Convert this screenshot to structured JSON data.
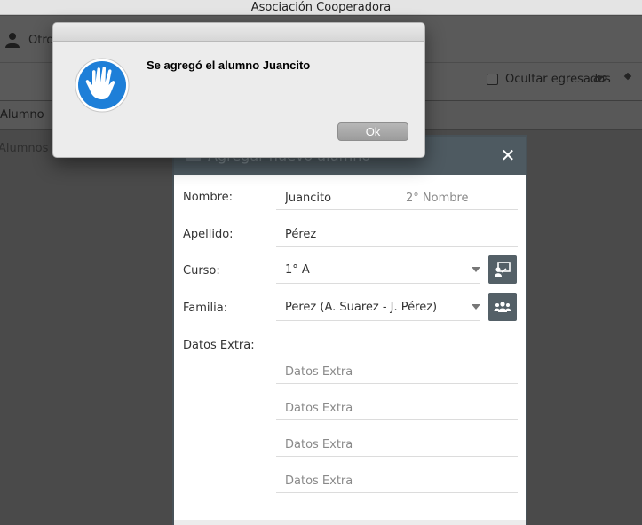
{
  "window": {
    "title": "Asociación Cooperadora"
  },
  "background_app": {
    "user_label": "Otro",
    "hide_graduates_label": "Ocultar egresados",
    "hide_graduates_checked": false,
    "table_header": "Alumno",
    "empty_text": "Alumnos p"
  },
  "modal": {
    "title": "Agregar nuevo alumno",
    "labels": {
      "nombre": "Nombre:",
      "apellido": "Apellido:",
      "curso": "Curso:",
      "familia": "Familia:",
      "datos_extra": "Datos Extra:"
    },
    "fields": {
      "nombre_value": "Juancito",
      "segundo_nombre_placeholder": "2° Nombre",
      "apellido_value": "Pérez",
      "curso_selected": "1° A",
      "familia_selected": "Perez (A. Suarez - J.  Pérez)",
      "datos_extra_placeholder": "Datos Extra"
    }
  },
  "alert": {
    "message": "Se agregó el alumno Juancito",
    "ok_label": "Ok"
  },
  "colors": {
    "modal_header": "#4e5a61",
    "icon_button": "#546067",
    "alert_icon_blue": "#1e7fd8"
  }
}
